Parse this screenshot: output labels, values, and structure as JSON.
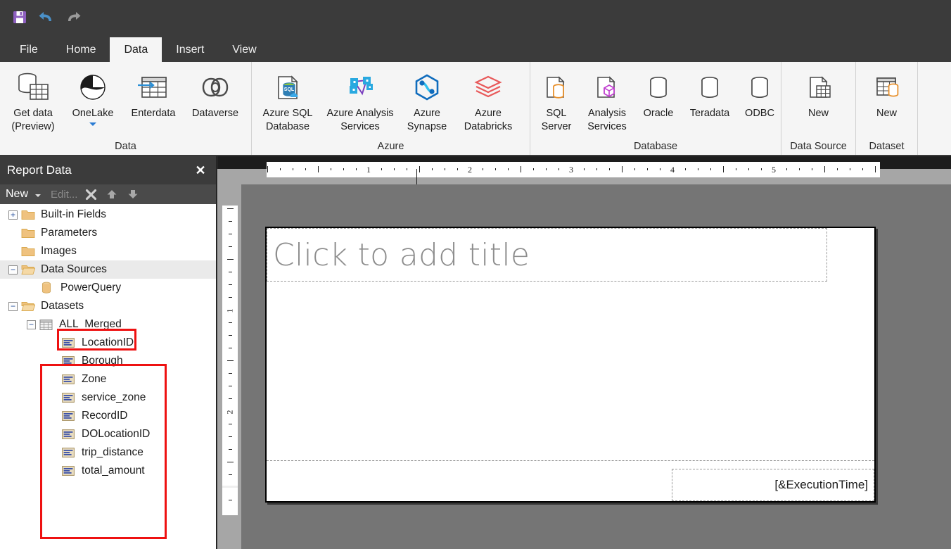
{
  "quick_access": {
    "save_label": "save-icon",
    "undo_label": "undo-icon",
    "redo_label": "redo-icon"
  },
  "ribbon": {
    "tabs": [
      {
        "label": "File",
        "active": false
      },
      {
        "label": "Home",
        "active": false
      },
      {
        "label": "Data",
        "active": true
      },
      {
        "label": "Insert",
        "active": false
      },
      {
        "label": "View",
        "active": false
      }
    ],
    "groups": [
      {
        "label": "Data",
        "items": [
          {
            "line1": "Get data",
            "line2": "(Preview)",
            "icon": "get-data-icon",
            "caret": false
          },
          {
            "line1": "OneLake",
            "line2": "",
            "icon": "onelake-icon",
            "caret": true
          },
          {
            "line1": "Enterdata",
            "line2": "",
            "icon": "enter-data-icon",
            "caret": false
          },
          {
            "line1": "Dataverse",
            "line2": "",
            "icon": "dataverse-icon",
            "caret": false
          }
        ]
      },
      {
        "label": "Azure",
        "items": [
          {
            "line1": "Azure SQL",
            "line2": "Database",
            "icon": "azure-sql-database-icon",
            "caret": false
          },
          {
            "line1": "Azure Analysis",
            "line2": "Services",
            "icon": "azure-analysis-services-icon",
            "caret": false
          },
          {
            "line1": "Azure",
            "line2": "Synapse",
            "icon": "azure-synapse-icon",
            "caret": false
          },
          {
            "line1": "Azure",
            "line2": "Databricks",
            "icon": "azure-databricks-icon",
            "caret": false
          }
        ]
      },
      {
        "label": "Database",
        "items": [
          {
            "line1": "SQL",
            "line2": "Server",
            "icon": "sql-server-icon",
            "caret": false
          },
          {
            "line1": "Analysis",
            "line2": "Services",
            "icon": "analysis-services-icon",
            "caret": false
          },
          {
            "line1": "Oracle",
            "line2": "",
            "icon": "oracle-icon",
            "caret": false
          },
          {
            "line1": "Teradata",
            "line2": "",
            "icon": "teradata-icon",
            "caret": false
          },
          {
            "line1": "ODBC",
            "line2": "",
            "icon": "odbc-icon",
            "caret": false
          }
        ]
      },
      {
        "label": "Data Source",
        "items": [
          {
            "line1": "New",
            "line2": "",
            "icon": "new-data-source-icon",
            "caret": false
          }
        ]
      },
      {
        "label": "Dataset",
        "items": [
          {
            "line1": "New",
            "line2": "",
            "icon": "new-dataset-icon",
            "caret": false
          }
        ]
      }
    ]
  },
  "report_data_panel": {
    "title": "Report Data",
    "close_label": "✕",
    "toolbar": {
      "new_label": "New",
      "edit_label": "Edit...",
      "delete_label": "delete-icon",
      "move_up_label": "move-up-icon",
      "move_down_label": "move-down-icon"
    },
    "tree": [
      {
        "label": "Built-in Fields",
        "icon": "folder-closed-icon",
        "indent": 0,
        "expander": "+",
        "selected": false
      },
      {
        "label": "Parameters",
        "icon": "folder-closed-icon",
        "indent": 0,
        "expander": "",
        "selected": false
      },
      {
        "label": "Images",
        "icon": "folder-closed-icon",
        "indent": 0,
        "expander": "",
        "selected": false
      },
      {
        "label": "Data Sources",
        "icon": "folder-open-icon",
        "indent": 0,
        "expander": "−",
        "selected": true
      },
      {
        "label": "PowerQuery",
        "icon": "data-source-cylinder-icon",
        "indent": 1,
        "expander": "",
        "selected": false
      },
      {
        "label": "Datasets",
        "icon": "folder-open-icon",
        "indent": 0,
        "expander": "−",
        "selected": false
      },
      {
        "label": "ALL_Merged",
        "icon": "dataset-grid-icon",
        "indent": 1,
        "expander": "−",
        "selected": false
      },
      {
        "label": "LocationID",
        "icon": "field-icon",
        "indent": 2,
        "expander": "",
        "selected": false
      },
      {
        "label": "Borough",
        "icon": "field-icon",
        "indent": 2,
        "expander": "",
        "selected": false
      },
      {
        "label": "Zone",
        "icon": "field-icon",
        "indent": 2,
        "expander": "",
        "selected": false
      },
      {
        "label": "service_zone",
        "icon": "field-icon",
        "indent": 2,
        "expander": "",
        "selected": false
      },
      {
        "label": "RecordID",
        "icon": "field-icon",
        "indent": 2,
        "expander": "",
        "selected": false
      },
      {
        "label": "DOLocationID",
        "icon": "field-icon",
        "indent": 2,
        "expander": "",
        "selected": false
      },
      {
        "label": "trip_distance",
        "icon": "field-icon",
        "indent": 2,
        "expander": "",
        "selected": false
      },
      {
        "label": "total_amount",
        "icon": "field-icon",
        "indent": 2,
        "expander": "",
        "selected": false
      }
    ],
    "annotations": [
      {
        "name": "powerquery-highlight",
        "color": "#ee1111"
      },
      {
        "name": "all-merged-fields-highlight",
        "color": "#ee1111"
      }
    ]
  },
  "design_surface": {
    "title_placeholder": "Click to add title",
    "footer_expression": "[&ExecutionTime]",
    "h_ruler_numbers": [
      "1",
      "2",
      "3",
      "4",
      "5"
    ],
    "v_ruler_numbers": [
      "1",
      "2"
    ]
  }
}
